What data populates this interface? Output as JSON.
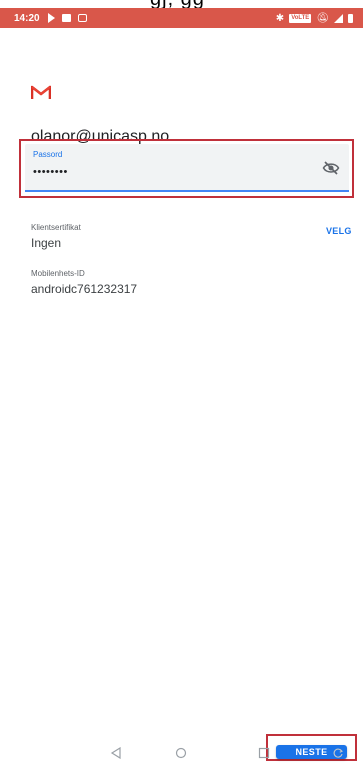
{
  "status_bar": {
    "time": "14:20",
    "volte_badge": "VoLTE"
  },
  "top_crop_text": "gj, gg",
  "account": {
    "email": "olanor@unicasp.no"
  },
  "password_field": {
    "label": "Passord",
    "value": "••••••••"
  },
  "client_certificate": {
    "label": "Klientsertifikat",
    "value": "Ingen",
    "action": "VELG"
  },
  "mobile_id": {
    "label": "Mobilenhets-ID",
    "value": "androidc761232317"
  },
  "next_button": {
    "label": "NESTE"
  },
  "colors": {
    "status_bar": "#d9574a",
    "accent_blue": "#1a73e8",
    "highlight_red": "#c0303a",
    "field_bg": "#f1f3f4"
  },
  "icons": {
    "logo": "gmail-icon",
    "visibility": "visibility-off-icon",
    "nav_back": "back-icon",
    "nav_home": "home-icon",
    "nav_recents": "recents-icon",
    "nav_rotate": "rotate-icon"
  }
}
